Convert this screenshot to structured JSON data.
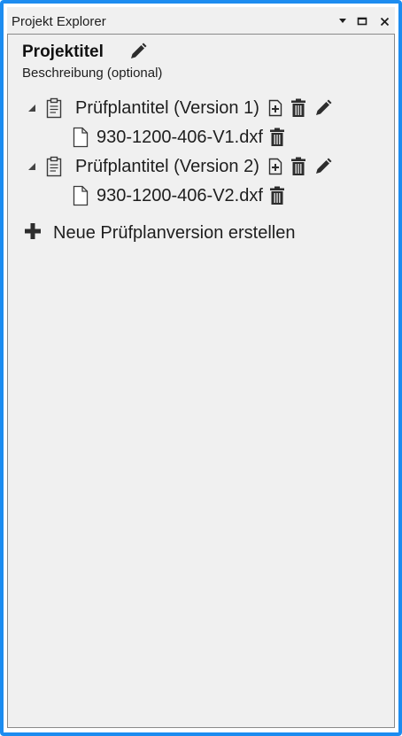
{
  "window": {
    "title": "Projekt Explorer",
    "accent_color": "#1c8cf0",
    "controls": [
      "dropdown-icon",
      "maximize-icon",
      "close-icon"
    ]
  },
  "project": {
    "title": "Projektitel",
    "description": "Beschreibung (optional)"
  },
  "plans": [
    {
      "label": "Prüfplantitel (Version 1)",
      "file": "930-1200-406-V1.dxf",
      "expanded": true
    },
    {
      "label": "Prüfplantitel (Version 2)",
      "file": "930-1200-406-V2.dxf",
      "expanded": true
    }
  ],
  "actions": {
    "new_version_label": "Neue Prüfplanversion erstellen"
  },
  "icons": {
    "expander": "expanded-triangle-icon",
    "plan": "clipboard-icon",
    "add_file": "add-file-icon",
    "delete": "trash-icon",
    "edit": "pencil-icon",
    "file": "file-icon",
    "new_version": "plus-icon"
  }
}
